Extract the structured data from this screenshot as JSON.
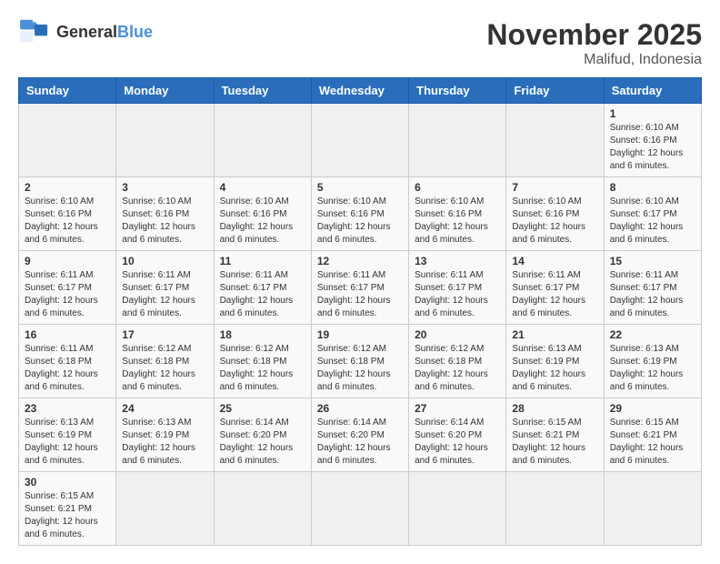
{
  "header": {
    "logo_general": "General",
    "logo_blue": "Blue",
    "month_title": "November 2025",
    "location": "Malifud, Indonesia"
  },
  "days_of_week": [
    "Sunday",
    "Monday",
    "Tuesday",
    "Wednesday",
    "Thursday",
    "Friday",
    "Saturday"
  ],
  "weeks": [
    [
      {
        "day": "",
        "info": ""
      },
      {
        "day": "",
        "info": ""
      },
      {
        "day": "",
        "info": ""
      },
      {
        "day": "",
        "info": ""
      },
      {
        "day": "",
        "info": ""
      },
      {
        "day": "",
        "info": ""
      },
      {
        "day": "1",
        "info": "Sunrise: 6:10 AM\nSunset: 6:16 PM\nDaylight: 12 hours\nand 6 minutes."
      }
    ],
    [
      {
        "day": "2",
        "info": "Sunrise: 6:10 AM\nSunset: 6:16 PM\nDaylight: 12 hours\nand 6 minutes."
      },
      {
        "day": "3",
        "info": "Sunrise: 6:10 AM\nSunset: 6:16 PM\nDaylight: 12 hours\nand 6 minutes."
      },
      {
        "day": "4",
        "info": "Sunrise: 6:10 AM\nSunset: 6:16 PM\nDaylight: 12 hours\nand 6 minutes."
      },
      {
        "day": "5",
        "info": "Sunrise: 6:10 AM\nSunset: 6:16 PM\nDaylight: 12 hours\nand 6 minutes."
      },
      {
        "day": "6",
        "info": "Sunrise: 6:10 AM\nSunset: 6:16 PM\nDaylight: 12 hours\nand 6 minutes."
      },
      {
        "day": "7",
        "info": "Sunrise: 6:10 AM\nSunset: 6:16 PM\nDaylight: 12 hours\nand 6 minutes."
      },
      {
        "day": "8",
        "info": "Sunrise: 6:10 AM\nSunset: 6:17 PM\nDaylight: 12 hours\nand 6 minutes."
      }
    ],
    [
      {
        "day": "9",
        "info": "Sunrise: 6:11 AM\nSunset: 6:17 PM\nDaylight: 12 hours\nand 6 minutes."
      },
      {
        "day": "10",
        "info": "Sunrise: 6:11 AM\nSunset: 6:17 PM\nDaylight: 12 hours\nand 6 minutes."
      },
      {
        "day": "11",
        "info": "Sunrise: 6:11 AM\nSunset: 6:17 PM\nDaylight: 12 hours\nand 6 minutes."
      },
      {
        "day": "12",
        "info": "Sunrise: 6:11 AM\nSunset: 6:17 PM\nDaylight: 12 hours\nand 6 minutes."
      },
      {
        "day": "13",
        "info": "Sunrise: 6:11 AM\nSunset: 6:17 PM\nDaylight: 12 hours\nand 6 minutes."
      },
      {
        "day": "14",
        "info": "Sunrise: 6:11 AM\nSunset: 6:17 PM\nDaylight: 12 hours\nand 6 minutes."
      },
      {
        "day": "15",
        "info": "Sunrise: 6:11 AM\nSunset: 6:17 PM\nDaylight: 12 hours\nand 6 minutes."
      }
    ],
    [
      {
        "day": "16",
        "info": "Sunrise: 6:11 AM\nSunset: 6:18 PM\nDaylight: 12 hours\nand 6 minutes."
      },
      {
        "day": "17",
        "info": "Sunrise: 6:12 AM\nSunset: 6:18 PM\nDaylight: 12 hours\nand 6 minutes."
      },
      {
        "day": "18",
        "info": "Sunrise: 6:12 AM\nSunset: 6:18 PM\nDaylight: 12 hours\nand 6 minutes."
      },
      {
        "day": "19",
        "info": "Sunrise: 6:12 AM\nSunset: 6:18 PM\nDaylight: 12 hours\nand 6 minutes."
      },
      {
        "day": "20",
        "info": "Sunrise: 6:12 AM\nSunset: 6:18 PM\nDaylight: 12 hours\nand 6 minutes."
      },
      {
        "day": "21",
        "info": "Sunrise: 6:13 AM\nSunset: 6:19 PM\nDaylight: 12 hours\nand 6 minutes."
      },
      {
        "day": "22",
        "info": "Sunrise: 6:13 AM\nSunset: 6:19 PM\nDaylight: 12 hours\nand 6 minutes."
      }
    ],
    [
      {
        "day": "23",
        "info": "Sunrise: 6:13 AM\nSunset: 6:19 PM\nDaylight: 12 hours\nand 6 minutes."
      },
      {
        "day": "24",
        "info": "Sunrise: 6:13 AM\nSunset: 6:19 PM\nDaylight: 12 hours\nand 6 minutes."
      },
      {
        "day": "25",
        "info": "Sunrise: 6:14 AM\nSunset: 6:20 PM\nDaylight: 12 hours\nand 6 minutes."
      },
      {
        "day": "26",
        "info": "Sunrise: 6:14 AM\nSunset: 6:20 PM\nDaylight: 12 hours\nand 6 minutes."
      },
      {
        "day": "27",
        "info": "Sunrise: 6:14 AM\nSunset: 6:20 PM\nDaylight: 12 hours\nand 6 minutes."
      },
      {
        "day": "28",
        "info": "Sunrise: 6:15 AM\nSunset: 6:21 PM\nDaylight: 12 hours\nand 6 minutes."
      },
      {
        "day": "29",
        "info": "Sunrise: 6:15 AM\nSunset: 6:21 PM\nDaylight: 12 hours\nand 6 minutes."
      }
    ],
    [
      {
        "day": "30",
        "info": "Sunrise: 6:15 AM\nSunset: 6:21 PM\nDaylight: 12 hours\nand 6 minutes."
      },
      {
        "day": "",
        "info": ""
      },
      {
        "day": "",
        "info": ""
      },
      {
        "day": "",
        "info": ""
      },
      {
        "day": "",
        "info": ""
      },
      {
        "day": "",
        "info": ""
      },
      {
        "day": "",
        "info": ""
      }
    ]
  ]
}
